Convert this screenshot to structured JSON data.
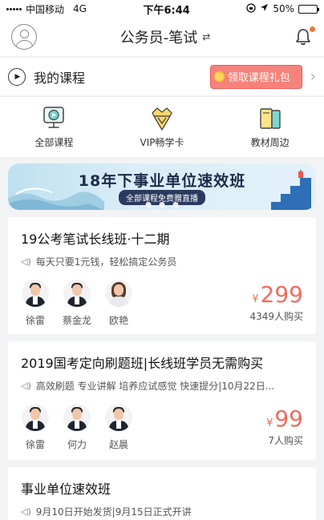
{
  "status_bar": {
    "carrier": "中国移动",
    "network": "4G",
    "time": "下午6:44",
    "battery_percent": "50%",
    "battery_level": 0.5
  },
  "header": {
    "title": "公务员-笔试",
    "swap_icon": "⇄"
  },
  "my_course": {
    "label": "我的课程",
    "gift_button": "领取课程礼包",
    "chevron": "›"
  },
  "quick_nav": [
    {
      "label": "全部课程",
      "icon": "play-video-icon"
    },
    {
      "label": "VIP畅学卡",
      "icon": "vip-crown-icon"
    },
    {
      "label": "教材周边",
      "icon": "books-icon"
    }
  ],
  "banner": {
    "title": "18年下事业单位速效班",
    "subtitle": "全部课程免费赠直播"
  },
  "courses": [
    {
      "title": "19公考笔试长线班·十二期",
      "desc": "每天只要1元钱，轻松搞定公务员",
      "teachers": [
        "徐雷",
        "蔡金龙",
        "欧艳"
      ],
      "currency": "¥",
      "price": "299",
      "buyers": "4349人购买"
    },
    {
      "title": "2019国考定向刷题班|长线班学员无需购买",
      "desc": "高效刷题 专业讲解 培养应试感觉 快速提分|10月22日...",
      "teachers": [
        "徐雷",
        "何力",
        "赵晨"
      ],
      "currency": "¥",
      "price": "99",
      "buyers": "7人购买"
    },
    {
      "title": "事业单位速效班",
      "desc": "9月10日开始发货|9月15日正式开讲"
    }
  ],
  "colors": {
    "accent_price": "#f26b5c",
    "gift_button": "#f6837b",
    "notification_dot": "#ee7a2e"
  }
}
